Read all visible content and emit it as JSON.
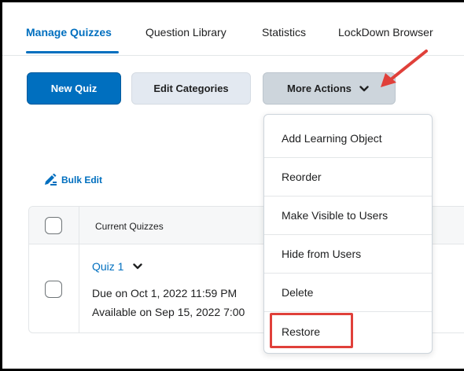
{
  "tabs": [
    {
      "label": "Manage Quizzes",
      "active": true
    },
    {
      "label": "Question Library",
      "active": false
    },
    {
      "label": "Statistics",
      "active": false
    },
    {
      "label": "LockDown Browser",
      "active": false
    }
  ],
  "toolbar": {
    "new_quiz_label": "New Quiz",
    "edit_categories_label": "Edit Categories",
    "more_actions_label": "More Actions"
  },
  "bulk_edit_label": "Bulk Edit",
  "table": {
    "header_label": "Current Quizzes",
    "rows": [
      {
        "title": "Quiz 1",
        "due": "Due on Oct 1, 2022 11:59 PM",
        "available": "Available on Sep 15, 2022 7:00"
      }
    ]
  },
  "dropdown": {
    "items": [
      "Add Learning Object",
      "Reorder",
      "Make Visible to Users",
      "Hide from Users",
      "Delete",
      "Restore"
    ],
    "highlighted_item": "Restore"
  },
  "icons": {
    "more_actions_chevron": "chevron-down-icon",
    "bulk_edit": "pencil-icon",
    "annotation_arrow": "arrow-icon",
    "quiz_chevron": "chevron-down-icon"
  },
  "colors": {
    "primary": "#006fbf",
    "annotation_red": "#e0403a",
    "secondary_button": "#e3e9f1",
    "more_actions_button": "#cdd5dc"
  }
}
